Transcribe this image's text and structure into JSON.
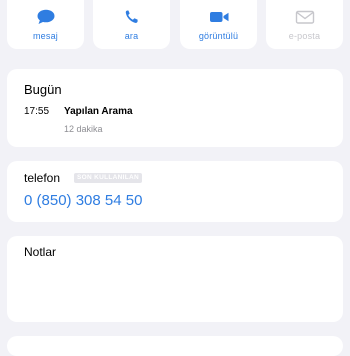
{
  "actions": [
    {
      "label": "mesaj",
      "icon": "message-bubble-icon",
      "enabled": true
    },
    {
      "label": "ara",
      "icon": "phone-handset-icon",
      "enabled": true
    },
    {
      "label": "görüntülü",
      "icon": "video-camera-icon",
      "enabled": true
    },
    {
      "label": "e-posta",
      "icon": "envelope-icon",
      "enabled": false
    }
  ],
  "recent": {
    "title": "Bugün",
    "time": "17:55",
    "kind": "Yapılan Arama",
    "duration": "12 dakika"
  },
  "phone": {
    "label": "telefon",
    "badge": "SON KULLANILAN",
    "number": "0 (850) 308 54 50"
  },
  "notes": {
    "title": "Notlar",
    "value": ""
  },
  "colors": {
    "accent": "#2f7de1",
    "disabled": "#c7c7cc",
    "background": "#f2f2f7"
  }
}
